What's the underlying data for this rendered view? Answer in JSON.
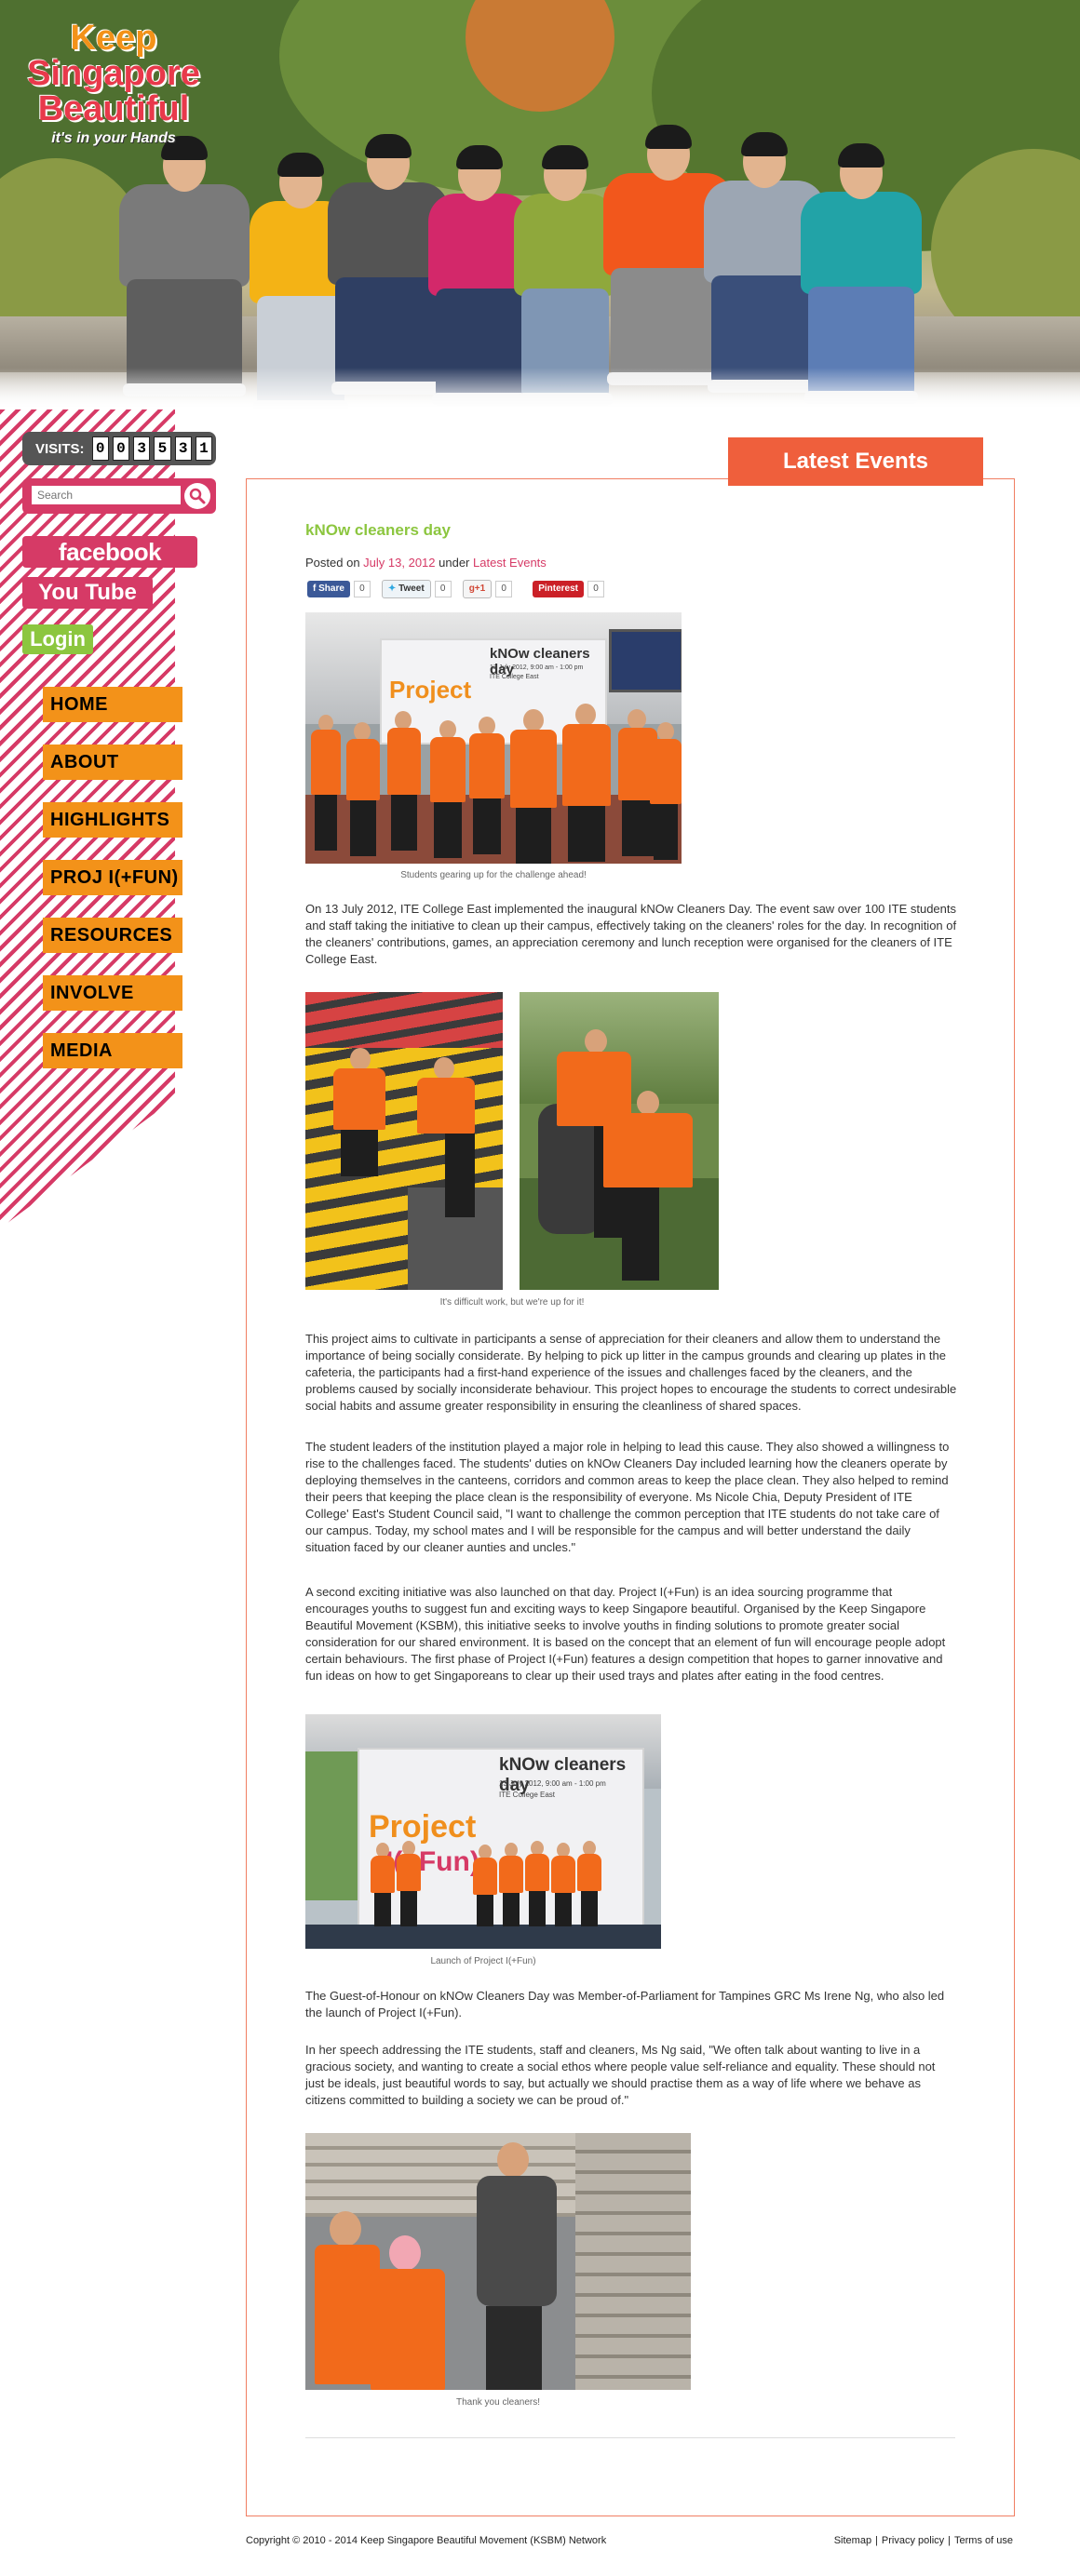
{
  "header": {
    "logo_line1": "Keep",
    "logo_line2": "Singapore",
    "logo_line3": "Beautiful",
    "logo_tagline": "it's in your Hands"
  },
  "sidebar": {
    "visits_label": "VISITS:",
    "visits_digits": [
      "0",
      "0",
      "3",
      "5",
      "3",
      "1"
    ],
    "search_placeholder": "Search",
    "facebook_label": "facebook",
    "youtube_label": "You Tube",
    "login_label": "Login",
    "nav": [
      "HOME",
      "ABOUT",
      "HIGHLIGHTS",
      "PROJ I(+FUN)",
      "RESOURCES",
      "INVOLVE",
      "MEDIA"
    ]
  },
  "section_tab": "Latest Events",
  "post": {
    "title": "kNOw cleaners day",
    "posted_prefix": "Posted on",
    "date": "July 13, 2012",
    "under_text": "under",
    "category": "Latest Events",
    "share": {
      "facebook": {
        "label": "Share",
        "count": "0"
      },
      "twitter": {
        "label": "Tweet",
        "count": "0"
      },
      "gplus": {
        "label": "+1",
        "count": "0"
      },
      "pinterest": {
        "label": "Pinterest",
        "count": "0"
      }
    },
    "photo1_banner_title": "kNOw cleaners day",
    "photo1_banner_sub": "13 July 2012, 9:00 am - 1:00 pm",
    "photo1_banner_place": "ITE College East",
    "photo1_caption": "Students gearing up for the challenge ahead!",
    "para1": "On 13 July 2012, ITE College East implemented the inaugural kNOw Cleaners Day. The event saw over 100 ITE students and staff taking the initiative to clean up their campus, effectively taking on the cleaners' roles for the day. In recognition of the cleaners' contributions, games, an appreciation ceremony and lunch reception were organised for the cleaners of ITE College East.",
    "photo2_caption": "It's difficult work, but we're up for it!",
    "para2": "This project aims to cultivate in participants a sense of appreciation for their cleaners and allow them to understand the importance of being socially considerate. By helping to pick up litter in the campus grounds and clearing up plates in the cafeteria, the participants had a first-hand experience of the issues and challenges faced by the cleaners, and the problems caused by socially inconsiderate behaviour. This project hopes to encourage the students to correct undesirable social habits and assume greater responsibility in ensuring the cleanliness of shared spaces.",
    "para3": "The student leaders of the institution played a major role in helping to lead this cause. They also showed a willingness to rise to the challenges faced. The students' duties on kNOw Cleaners Day included learning how the cleaners operate by deploying themselves in the canteens, corridors and common areas to keep the place clean. They also helped to remind their peers that keeping the place clean is the responsibility of everyone. Ms Nicole Chia, Deputy President of ITE College' East's Student Council said, \"I want to challenge the common perception that ITE students do not take care of our campus. Today, my school mates and I will be responsible for the campus and will better understand the daily situation faced by our cleaner aunties and uncles.\"",
    "para4": "A second exciting initiative was also launched on that day. Project I(+Fun) is an idea sourcing programme that encourages youths to suggest fun and exciting ways to keep Singapore beautiful. Organised by the Keep Singapore Beautiful Movement (KSBM), this initiative seeks to involve youths in finding solutions to promote greater social consideration for our shared environment. It is based on the concept that an element of fun will encourage people adopt certain behaviours. The first phase of Project I(+Fun) features a design competition that hopes to garner innovative and fun ideas on how to get Singaporeans to clear up their used trays and plates after eating in the food centres.",
    "photo3_banner_title": "kNOw cleaners day",
    "photo3_banner_sub": "13 July 2012, 9:00 am - 1:00 pm",
    "photo3_banner_place": "ITE College East",
    "photo3_project_word": "Project",
    "photo3_fun_word": "I(+Fun)",
    "photo3_caption": "Launch of Project I(+Fun)",
    "para5": "The Guest-of-Honour on kNOw Cleaners Day was Member-of-Parliament for Tampines GRC Ms Irene Ng, who also led the launch of Project I(+Fun).",
    "para6": "In her speech addressing the ITE students, staff and cleaners, Ms Ng said, \"We often talk about wanting to live in a gracious society, and wanting to create a social ethos where people value self-reliance and equality. These should not just be ideals, just beautiful words to say, but actually we should practise them as a way of life where we behave as citizens committed to building a society we can be proud of.\"",
    "photo4_caption": "Thank you cleaners!"
  },
  "footer": {
    "copyright": "Copyright © 2010 - 2014 Keep Singapore Beautiful Movement (KSBM) Network",
    "links": [
      "Sitemap",
      "Privacy policy",
      "Terms of use"
    ]
  },
  "colors": {
    "accent_pink": "#d63a66",
    "accent_orange": "#ef5f3c",
    "nav_orange": "#f39219",
    "title_green": "#8cc63f"
  }
}
